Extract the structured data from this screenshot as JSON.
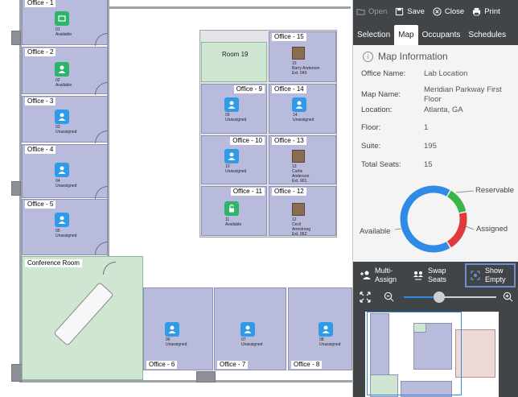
{
  "floor": {
    "offices": [
      {
        "name": "Office - 1",
        "seat": "01",
        "status": "Available",
        "seat_color": "green"
      },
      {
        "name": "Office - 2",
        "seat": "02",
        "status": "Available",
        "seat_color": "green"
      },
      {
        "name": "Office - 3",
        "seat": "03",
        "status": "Unassigned",
        "seat_color": "blue"
      },
      {
        "name": "Office - 4",
        "seat": "04",
        "status": "Unassigned",
        "seat_color": "blue"
      },
      {
        "name": "Office - 5",
        "seat": "05",
        "status": "Unassigned",
        "seat_color": "blue"
      },
      {
        "name": "Office - 6",
        "seat": "06",
        "status": "Unassigned",
        "seat_color": "blue"
      },
      {
        "name": "Office - 7",
        "seat": "07",
        "status": "Unassigned",
        "seat_color": "blue"
      },
      {
        "name": "Office - 8",
        "seat": "08",
        "status": "Unassigned",
        "seat_color": "blue"
      },
      {
        "name": "Office - 9",
        "seat": "09",
        "status": "Unassigned",
        "seat_color": "blue"
      },
      {
        "name": "Office - 10",
        "seat": "10",
        "status": "Unassigned",
        "seat_color": "blue"
      },
      {
        "name": "Office - 11",
        "seat": "11",
        "status": "Available",
        "seat_color": "green"
      },
      {
        "name": "Office - 12",
        "seat": "12",
        "occupant": "Cecil Armstrong",
        "ext": "Ext. 962"
      },
      {
        "name": "Office - 13",
        "seat": "13",
        "occupant": "Curtis Anderson",
        "ext": "Ext. 901"
      },
      {
        "name": "Office - 14",
        "seat": "14",
        "status": "Unassigned",
        "seat_color": "blue"
      },
      {
        "name": "Office - 15",
        "seat": "15",
        "occupant": "Barry Anderson",
        "ext": "Ext. 049"
      }
    ],
    "room19": "Room 19",
    "conference": "Conference Room"
  },
  "panel": {
    "toolbar": {
      "open": "Open",
      "save": "Save",
      "close": "Close",
      "print": "Print"
    },
    "tabs": [
      "Selection",
      "Map",
      "Occupants",
      "Schedules"
    ],
    "active_tab": "Map",
    "info": {
      "title": "Map Information",
      "rows": [
        {
          "k": "Office Name:",
          "v": "Lab Location"
        },
        {
          "k": "Map Name:",
          "v": "Meridian Parkway First Floor"
        },
        {
          "k": "Location:",
          "v": "Atlanta, GA"
        },
        {
          "k": "Floor:",
          "v": "1"
        },
        {
          "k": "Suite:",
          "v": "195"
        },
        {
          "k": "Total Seats:",
          "v": "15"
        }
      ]
    },
    "donut": {
      "labels": {
        "reservable": "Reservable",
        "assigned": "Assigned",
        "available": "Available"
      },
      "segments": [
        {
          "name": "Available",
          "fraction": 0.67,
          "color": "#2f8be6"
        },
        {
          "name": "Reservable",
          "fraction": 0.13,
          "color": "#39b54a"
        },
        {
          "name": "Assigned",
          "fraction": 0.2,
          "color": "#e03a3a"
        }
      ]
    },
    "actions": {
      "multi_assign": "Multi-\nAssign",
      "swap_seats": "Swap\nSeats",
      "show_empty": "Show\nEmpty"
    },
    "zoom": {
      "level": 0.38
    }
  }
}
